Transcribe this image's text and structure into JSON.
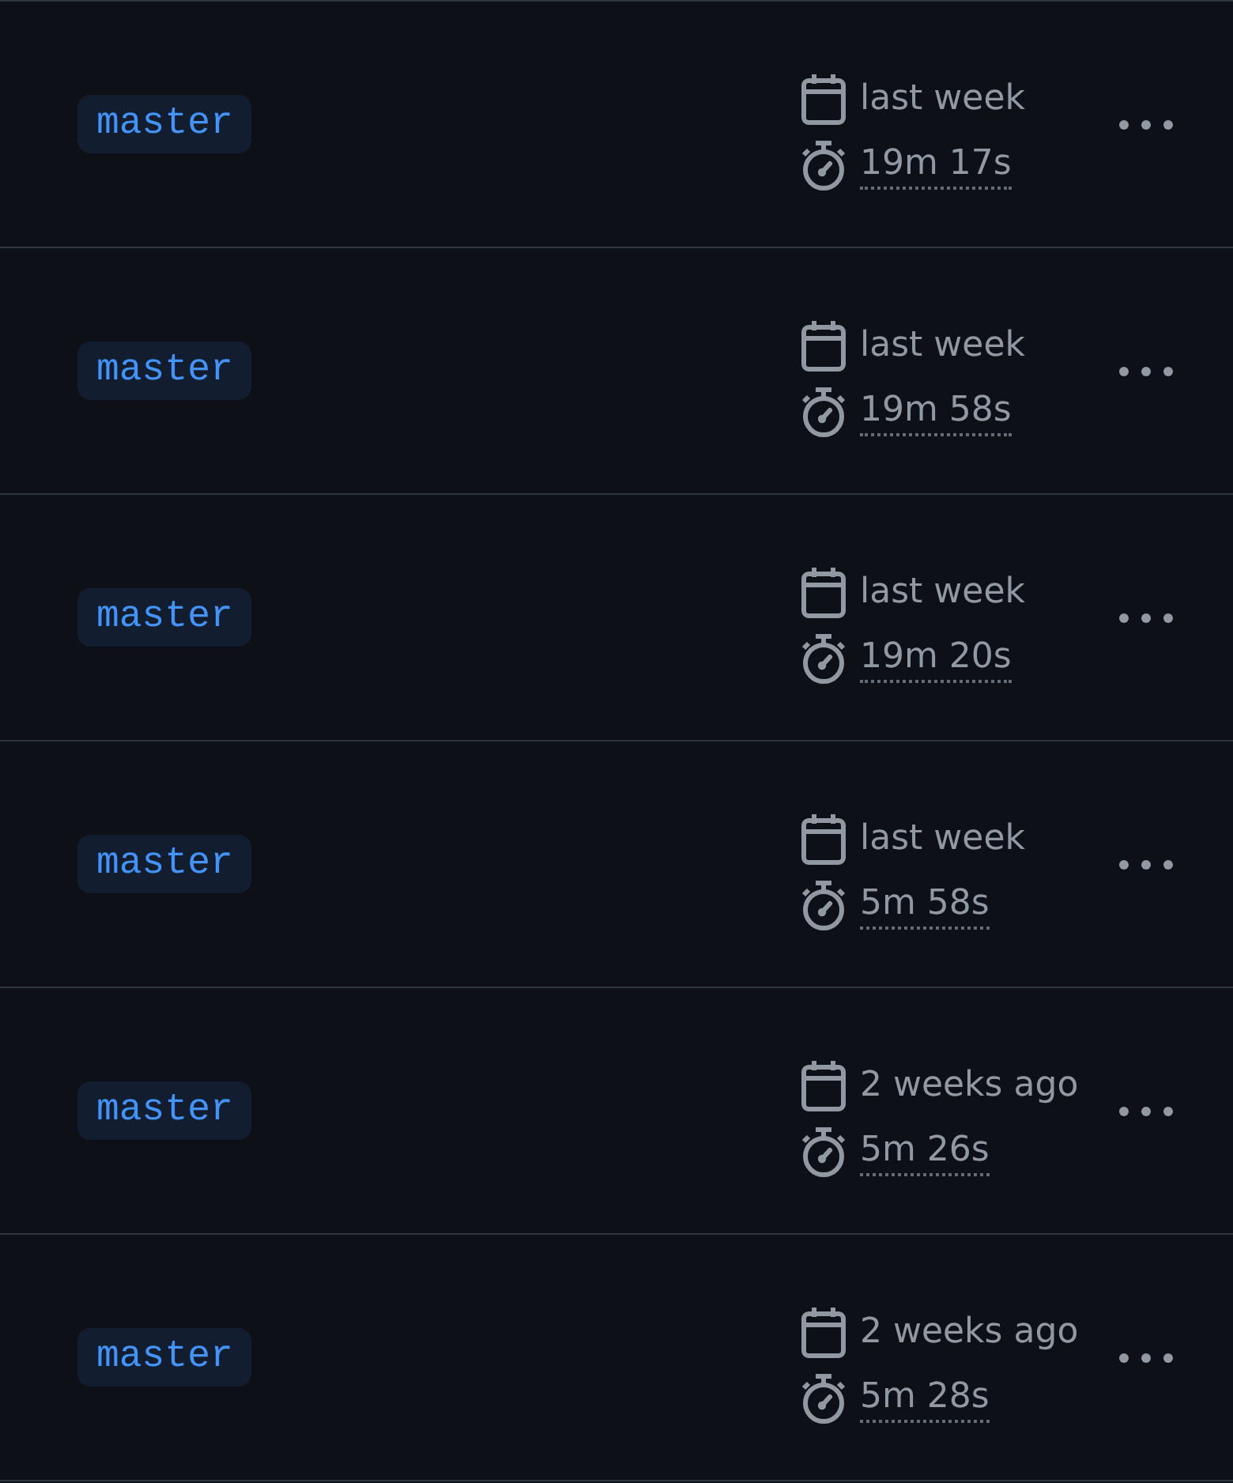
{
  "runs": [
    {
      "branch": "master",
      "date": "last week",
      "duration": "19m 17s"
    },
    {
      "branch": "master",
      "date": "last week",
      "duration": "19m 58s"
    },
    {
      "branch": "master",
      "date": "last week",
      "duration": "19m 20s"
    },
    {
      "branch": "master",
      "date": "last week",
      "duration": "5m 58s"
    },
    {
      "branch": "master",
      "date": "2 weeks ago",
      "duration": "5m 26s"
    },
    {
      "branch": "master",
      "date": "2 weeks ago",
      "duration": "5m 28s"
    }
  ]
}
